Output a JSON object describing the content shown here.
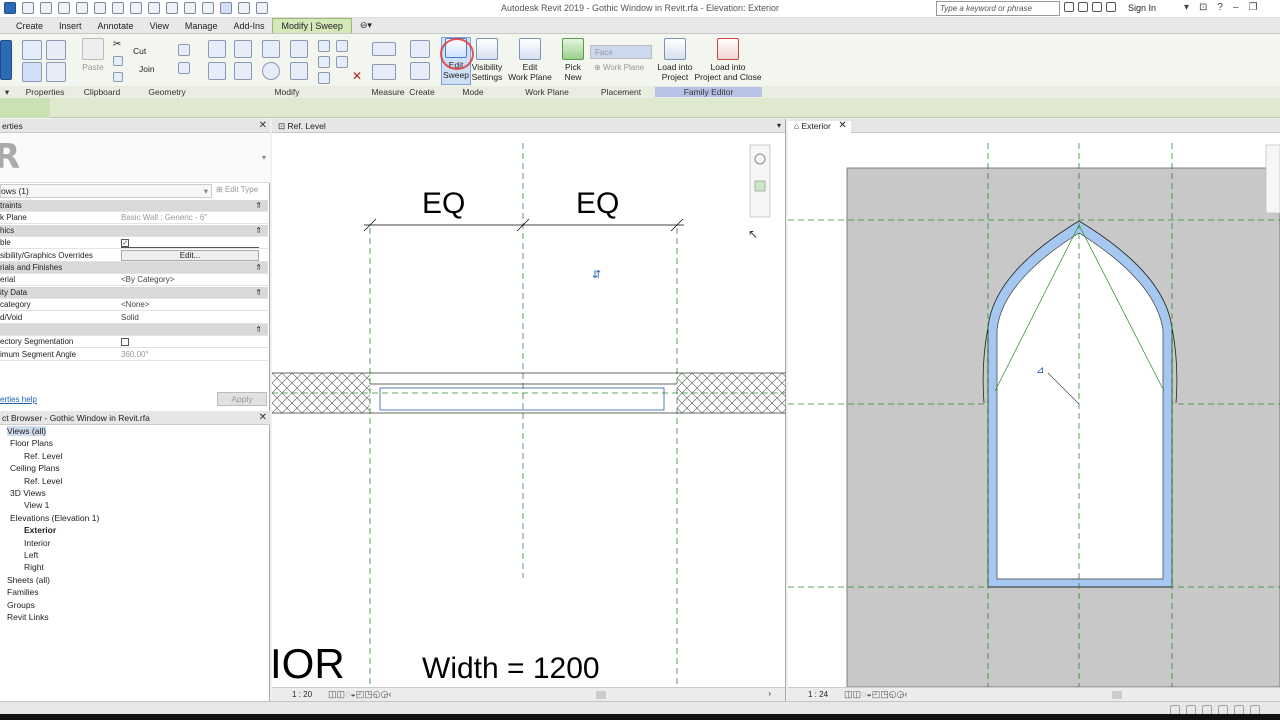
{
  "app": {
    "title": "Autodesk Revit 2019 - Gothic Window in Revit.rfa - Elevation: Exterior",
    "search_placeholder": "Type a keyword or phrase",
    "sign_in": "Sign In"
  },
  "tabs": [
    "Create",
    "Insert",
    "Annotate",
    "View",
    "Manage",
    "Add-Ins",
    "Modify | Sweep"
  ],
  "ribbon": {
    "clipboard": {
      "paste": "Paste",
      "cut": "Cut",
      "join": "Join"
    },
    "buttons": {
      "edit_sweep": "Edit\nSweep",
      "visibility_settings": "Visibility\nSettings",
      "edit_work_plane": "Edit\nWork Plane",
      "pick_new": "Pick\nNew",
      "face": "Face",
      "work_plane": "Work Plane",
      "load_into_project": "Load into\nProject",
      "load_into_project_and_close": "Load into\nProject and Close"
    },
    "panels": {
      "properties": "Properties",
      "clipboard": "Clipboard",
      "geometry": "Geometry",
      "modify": "Modify",
      "measure": "Measure",
      "create": "Create",
      "mode": "Mode",
      "work_plane": "Work Plane",
      "placement": "Placement",
      "family_editor": "Family Editor"
    }
  },
  "properties": {
    "header": "erties",
    "selector": "ows (1)",
    "edit_type": "Edit Type",
    "rows": [
      {
        "type": "group",
        "label": "traints"
      },
      {
        "type": "row",
        "key": "k Plane",
        "value": "Basic Wall : Generic - 6\"",
        "gray": true
      },
      {
        "type": "group",
        "label": "hics"
      },
      {
        "type": "check",
        "key": "ble",
        "checked": true
      },
      {
        "type": "button",
        "key": "sibility/Graphics Overrides",
        "value": "Edit..."
      },
      {
        "type": "group",
        "label": "rials and Finishes"
      },
      {
        "type": "row",
        "key": "erial",
        "value": "<By Category>"
      },
      {
        "type": "group",
        "label": "ity Data"
      },
      {
        "type": "row",
        "key": "category",
        "value": "<None>"
      },
      {
        "type": "row",
        "key": "d/Void",
        "value": "Solid"
      },
      {
        "type": "group",
        "label": ""
      },
      {
        "type": "check",
        "key": "ectory Segmentation",
        "checked": false
      },
      {
        "type": "row",
        "key": "imum Segment Angle",
        "value": "360.00°",
        "gray": true
      }
    ],
    "help_link": "erties help",
    "apply": "Apply"
  },
  "browser": {
    "header": "ct Browser - Gothic Window in Revit.rfa",
    "items": [
      {
        "label": "Views (all)",
        "indent": 0,
        "sel": true
      },
      {
        "label": "Floor Plans",
        "indent": 1
      },
      {
        "label": "Ref. Level",
        "indent": 2
      },
      {
        "label": "Ceiling Plans",
        "indent": 1
      },
      {
        "label": "Ref. Level",
        "indent": 2
      },
      {
        "label": "3D Views",
        "indent": 1
      },
      {
        "label": "View 1",
        "indent": 2
      },
      {
        "label": "Elevations (Elevation 1)",
        "indent": 1
      },
      {
        "label": "Exterior",
        "indent": 2,
        "bold": true
      },
      {
        "label": "Interior",
        "indent": 2
      },
      {
        "label": "Left",
        "indent": 2
      },
      {
        "label": "Right",
        "indent": 2
      },
      {
        "label": "Sheets (all)",
        "indent": 0
      },
      {
        "label": "Families",
        "indent": 0
      },
      {
        "label": "Groups",
        "indent": 0
      },
      {
        "label": "Revit Links",
        "indent": 0
      }
    ]
  },
  "view_plan": {
    "tab": "Ref. Level",
    "eq_left": "EQ",
    "eq_right": "EQ",
    "width_label": "Width = 1200",
    "big_text": "IOR",
    "scale": "1 : 20"
  },
  "view_elev": {
    "tab": "Exterior",
    "scale": "1 : 24"
  },
  "colors": {
    "ribbon_active_tab": "#d4e8b8",
    "family_editor": "#b7c3e6",
    "sweep_blue": "#a6c8f0",
    "ref_plane_green": "#2a8a2a",
    "elev_gray": "#c8c8c8"
  }
}
